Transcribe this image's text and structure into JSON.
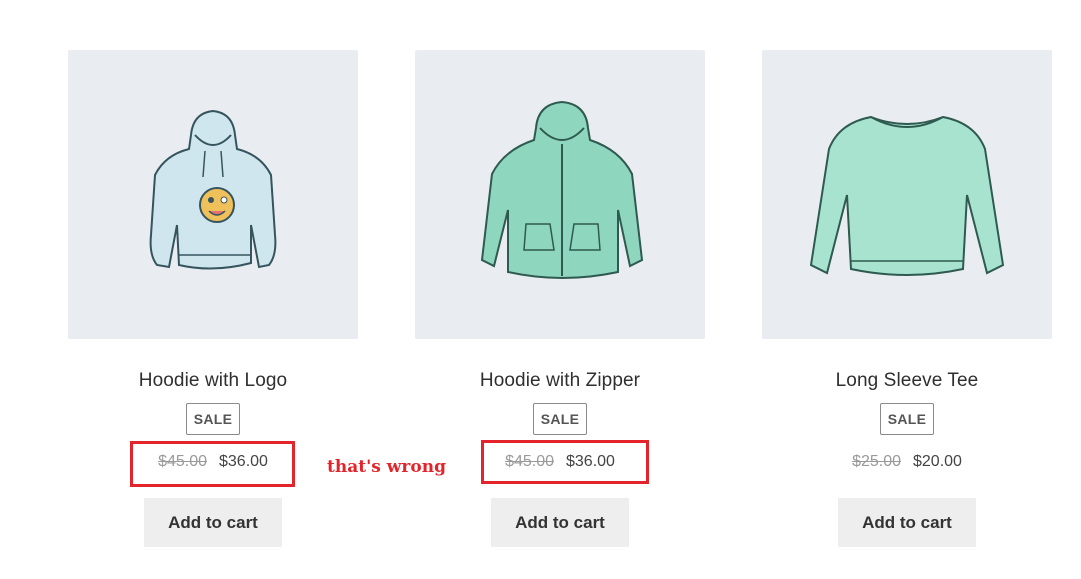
{
  "products": [
    {
      "title": "Hoodie with Logo",
      "badge": "SALE",
      "old_price": "$45.00",
      "price": "$36.00",
      "button": "Add to cart",
      "image_icon": "hoodie-with-logo-image"
    },
    {
      "title": "Hoodie with Zipper",
      "badge": "SALE",
      "old_price": "$45.00",
      "price": "$36.00",
      "button": "Add to cart",
      "image_icon": "hoodie-with-zipper-image"
    },
    {
      "title": "Long Sleeve Tee",
      "badge": "SALE",
      "old_price": "$25.00",
      "price": "$20.00",
      "button": "Add to cart",
      "image_icon": "long-sleeve-tee-image"
    }
  ],
  "annotation": {
    "text": "that's wrong",
    "color": "#e3242b"
  },
  "colors": {
    "thumb_bg": "#e9edf1",
    "button_bg": "#eeeeee",
    "highlight": "#e3242b"
  }
}
